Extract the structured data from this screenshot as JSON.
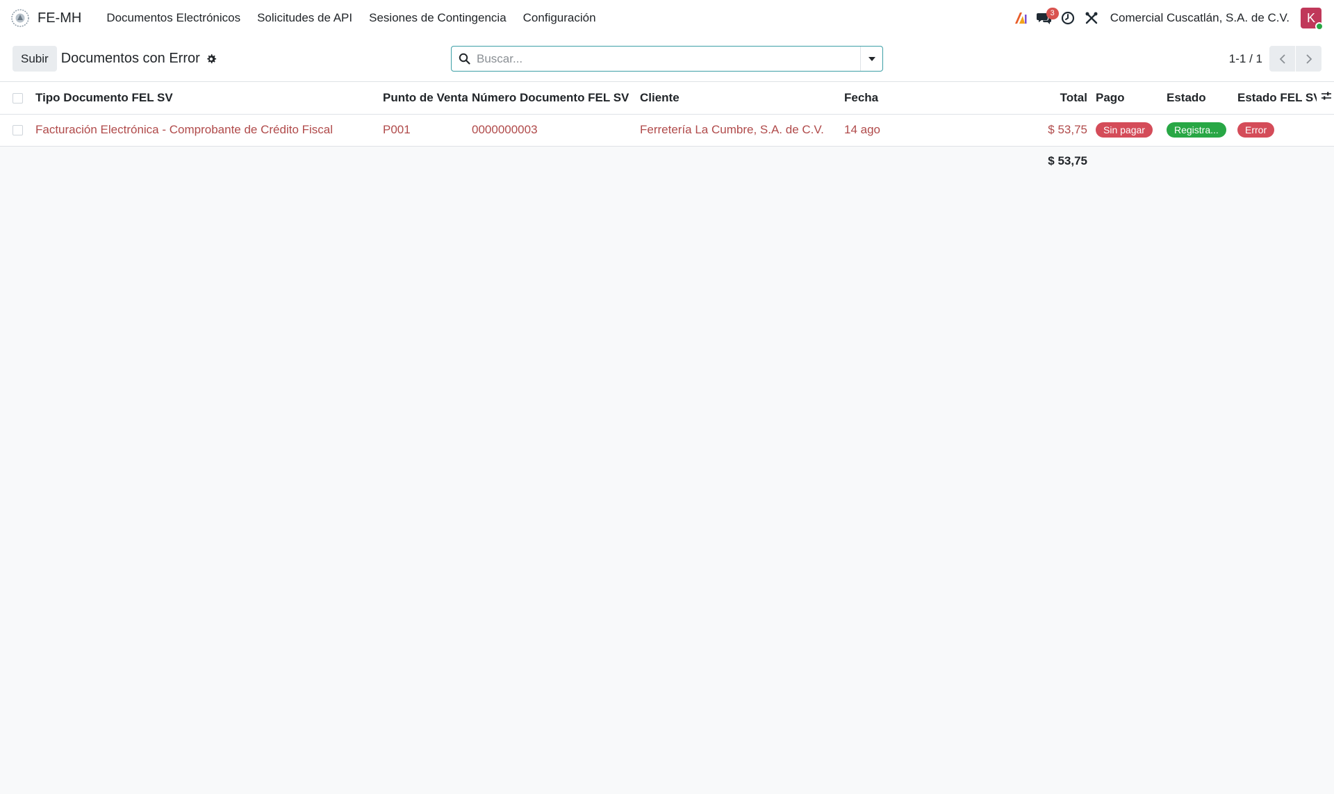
{
  "navbar": {
    "app_name": "FE-MH",
    "menu": [
      {
        "label": "Documentos Electrónicos"
      },
      {
        "label": "Solicitudes de API"
      },
      {
        "label": "Sesiones de Contingencia"
      },
      {
        "label": "Configuración"
      }
    ],
    "messages_count": "3",
    "company": "Comercial Cuscatlán, S.A. de C.V.",
    "user_initial": "K"
  },
  "control_panel": {
    "upload_label": "Subir",
    "title": "Documentos con Error",
    "search_placeholder": "Buscar...",
    "pager": "1-1 / 1"
  },
  "table": {
    "columns": {
      "tipo": "Tipo Documento FEL SV",
      "punto": "Punto de Venta",
      "numero": "Número Documento FEL SV",
      "cliente": "Cliente",
      "fecha": "Fecha",
      "total": "Total",
      "pago": "Pago",
      "estado": "Estado",
      "estado_fel": "Estado FEL SV"
    },
    "rows": [
      {
        "tipo": "Facturación Electrónica - Comprobante de Crédito Fiscal",
        "punto": "P001",
        "numero": "0000000003",
        "cliente": "Ferretería La Cumbre, S.A. de C.V.",
        "fecha": "14 ago",
        "total": "$ 53,75",
        "pago": "Sin pagar",
        "estado": "Registra...",
        "estado_fel": "Error"
      }
    ],
    "sum_total": "$ 53,75"
  },
  "colors": {
    "link_red": "#b04a4a",
    "badge_red": "#d44c59",
    "badge_green": "#28a745",
    "search_border": "#3c9fa6"
  }
}
